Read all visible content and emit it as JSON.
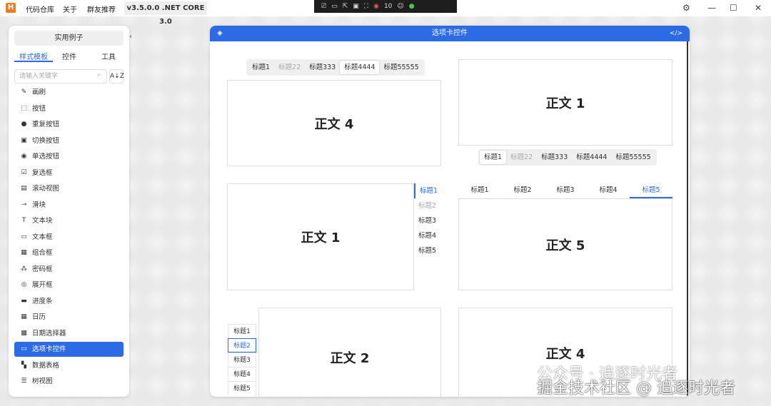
{
  "titlebar": {
    "logo": "H",
    "menu": [
      "代码仓库",
      "关于",
      "群友推荐"
    ],
    "version": "v3.5.0.0 .NET CORE 3.0",
    "recorder_count": "10"
  },
  "sidebar": {
    "examples_button": "实用例子",
    "tabs": [
      "样式模板",
      "控件",
      "工具"
    ],
    "search_placeholder": "请输入关键字",
    "sort_label": "A↓Z",
    "items": [
      {
        "label": "画刷",
        "icon": "✎"
      },
      {
        "label": "按钮",
        "icon": "⬚"
      },
      {
        "label": "重复按钮",
        "icon": "●"
      },
      {
        "label": "切换按钮",
        "icon": "▣"
      },
      {
        "label": "单选按钮",
        "icon": "◉"
      },
      {
        "label": "复选框",
        "icon": "☑"
      },
      {
        "label": "滚动视图",
        "icon": "▤"
      },
      {
        "label": "滑块",
        "icon": "⊸"
      },
      {
        "label": "文本块",
        "icon": "T"
      },
      {
        "label": "文本框",
        "icon": "▭"
      },
      {
        "label": "组合框",
        "icon": "▦"
      },
      {
        "label": "密码框",
        "icon": "⁂"
      },
      {
        "label": "展开框",
        "icon": "◎"
      },
      {
        "label": "进度条",
        "icon": "▬"
      },
      {
        "label": "日历",
        "icon": "▦"
      },
      {
        "label": "日期选择器",
        "icon": "▩"
      },
      {
        "label": "选项卡控件",
        "icon": "▭"
      },
      {
        "label": "数据表格",
        "icon": "▚"
      },
      {
        "label": "树视图",
        "icon": "☰"
      }
    ],
    "selected": "选项卡控件"
  },
  "main": {
    "title": "选项卡控件",
    "panel1": {
      "tabs": [
        "标题1",
        "标题22",
        "标题333",
        "标题4444",
        "标题55555"
      ],
      "content": "正文 4"
    },
    "panel2": {
      "tabs": [
        "标题1",
        "标题22",
        "标题333",
        "标题4444",
        "标题55555"
      ],
      "content": "正文 1"
    },
    "panel3": {
      "tabs": [
        "标题1",
        "标题2",
        "标题3",
        "标题4",
        "标题5"
      ],
      "content": "正文 1"
    },
    "panel4": {
      "tabs": [
        "标题1",
        "标题2",
        "标题3",
        "标题4",
        "标题5"
      ],
      "content": "正文 5"
    },
    "panel5": {
      "tabs": [
        "标题1",
        "标题2",
        "标题3",
        "标题4",
        "标题5"
      ],
      "content": "正文 2"
    },
    "panel6": {
      "content": "正文 4"
    }
  },
  "watermark": {
    "line1": "公众号 · 追逐时光者",
    "line2": "掘金技术社区 @ 追逐时光者"
  }
}
